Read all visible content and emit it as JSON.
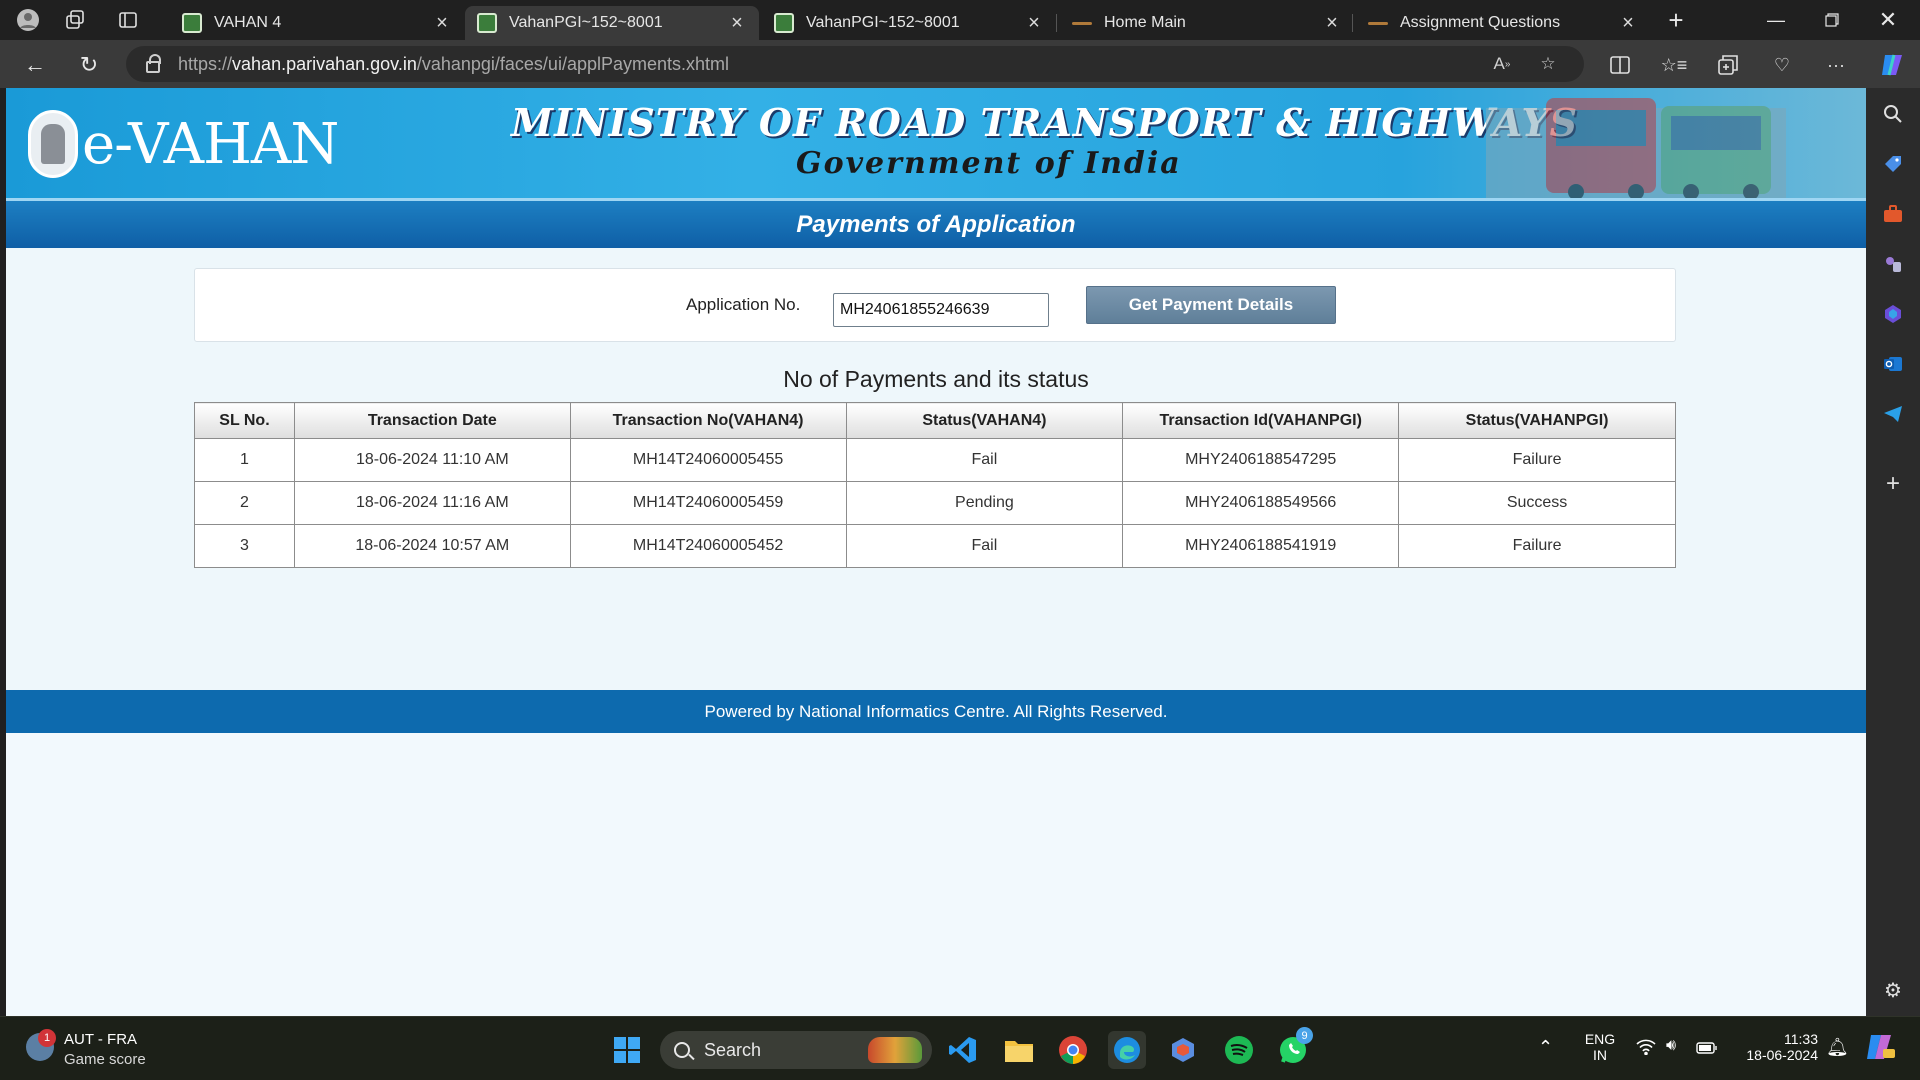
{
  "browser": {
    "tabs": [
      {
        "title": "VAHAN 4",
        "active": false
      },
      {
        "title": "VahanPGI~152~8001",
        "active": true
      },
      {
        "title": "VahanPGI~152~8001",
        "active": false
      },
      {
        "title": "Home Main",
        "active": false
      },
      {
        "title": "Assignment Questions",
        "active": false
      }
    ],
    "url_prefix": "https://",
    "url_host": "vahan.parivahan.gov.in",
    "url_path": "/vahanpgi/faces/ui/applPayments.xhtml"
  },
  "page": {
    "brand": "e-VAHAN",
    "ministry": "MINISTRY OF ROAD TRANSPORT & HIGHWAYS",
    "government": "Government of India",
    "heading": "Payments of Application",
    "form": {
      "application_label": "Application No.",
      "application_value": "MH24061855246639",
      "button_label": "Get Payment Details"
    },
    "table_title": "No of Payments and its status",
    "table": {
      "columns": [
        "SL No.",
        "Transaction Date",
        "Transaction No(VAHAN4)",
        "Status(VAHAN4)",
        "Transaction Id(VAHANPGI)",
        "Status(VAHANPGI)"
      ],
      "rows": [
        [
          "1",
          "18-06-2024 11:10 AM",
          "MH14T24060005455",
          "Fail",
          "MHY2406188547295",
          "Failure"
        ],
        [
          "2",
          "18-06-2024 11:16 AM",
          "MH14T24060005459",
          "Pending",
          "MHY2406188549566",
          "Success"
        ],
        [
          "3",
          "18-06-2024 10:57 AM",
          "MH14T24060005452",
          "Fail",
          "MHY2406188541919",
          "Failure"
        ]
      ]
    },
    "footer": "Powered by National Informatics Centre. All Rights Reserved."
  },
  "taskbar": {
    "weather_badge": "1",
    "weather_line1": "AUT - FRA",
    "weather_line2": "Game score",
    "search_label": "Search",
    "whatsapp_badge": "9",
    "lang_line1": "ENG",
    "lang_line2": "IN",
    "time": "11:33",
    "date": "18-06-2024"
  },
  "colors": {
    "header_blue": "#27a3dd",
    "pagebar_blue": "#0f5fa6",
    "footer_blue": "#0d6aae",
    "button_gray_blue": "#5f7f99"
  }
}
